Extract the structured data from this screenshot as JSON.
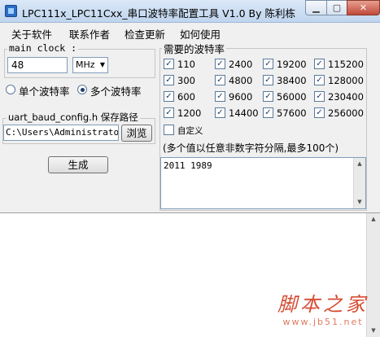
{
  "window": {
    "title": "LPC111x_LPC11Cxx_串口波特率配置工具 V1.0  By 陈利栋"
  },
  "window_controls": {
    "minimize": "▁",
    "maximize": "▢",
    "close": "✕"
  },
  "menu": [
    "关于软件",
    "联系作者",
    "检查更新",
    "如何使用"
  ],
  "clock": {
    "label": "main clock :",
    "value": "48",
    "unit": "MHz"
  },
  "mode": {
    "single": {
      "label": "单个波特率",
      "selected": false
    },
    "multi": {
      "label": "多个波特率",
      "selected": true
    }
  },
  "save": {
    "label": "uart_baud_config.h 保存路径",
    "path": "C:\\Users\\Administrator\\",
    "browse_label": "浏览"
  },
  "generate_label": "生成",
  "baud": {
    "title": "需要的波特率",
    "rows": [
      [
        {
          "v": "110",
          "checked": true
        },
        {
          "v": "2400",
          "checked": true
        },
        {
          "v": "19200",
          "checked": true
        },
        {
          "v": "115200",
          "checked": true
        }
      ],
      [
        {
          "v": "300",
          "checked": true
        },
        {
          "v": "4800",
          "checked": true
        },
        {
          "v": "38400",
          "checked": true
        },
        {
          "v": "128000",
          "checked": true
        }
      ],
      [
        {
          "v": "600",
          "checked": true
        },
        {
          "v": "9600",
          "checked": true
        },
        {
          "v": "56000",
          "checked": true
        },
        {
          "v": "230400",
          "checked": true
        }
      ],
      [
        {
          "v": "1200",
          "checked": true
        },
        {
          "v": "14400",
          "checked": true
        },
        {
          "v": "57600",
          "checked": true
        },
        {
          "v": "256000",
          "checked": true
        }
      ]
    ],
    "custom_label": "自定义",
    "custom_checked": false,
    "hint": "(多个值以任意非数字符分隔,最多100个)",
    "custom_value": "2011 1989"
  },
  "output": {
    "text": ""
  },
  "watermark": {
    "main": "脚本之家",
    "sub": "www.jb51.net"
  }
}
